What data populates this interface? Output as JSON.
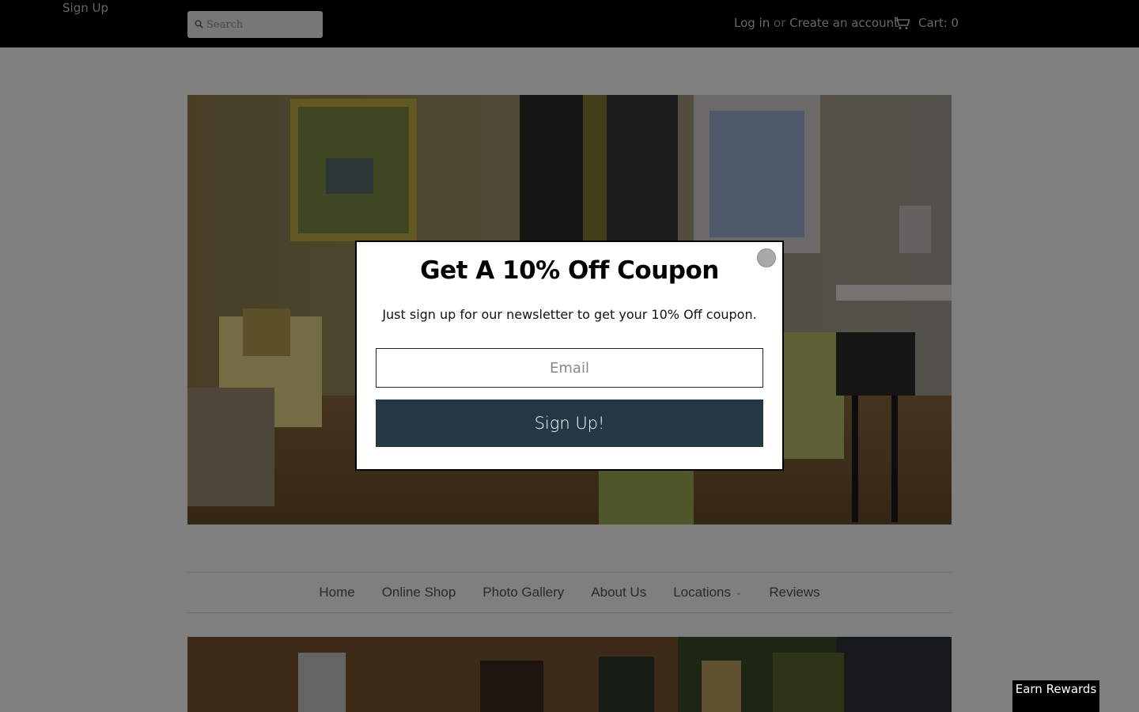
{
  "header": {
    "signup_label": "Sign Up",
    "search_placeholder": "Search",
    "login_label": "Log in",
    "or_text": "or",
    "create_account_label": "Create an account",
    "cart_label": "Cart: 0"
  },
  "nav": {
    "items": [
      "Home",
      "Online Shop",
      "Photo Gallery",
      "About Us",
      "Locations",
      "Reviews"
    ]
  },
  "popup": {
    "title": "Get A 10% Off Coupon",
    "subtitle": "Just sign up for our newsletter to get your 10% Off coupon.",
    "email_placeholder": "Email",
    "button_label": "Sign Up!"
  },
  "rewards": {
    "label": "Earn Rewards"
  },
  "colors": {
    "topbar": "#000000",
    "button": "#243745",
    "overlay": "rgba(0,0,0,0.5)"
  }
}
